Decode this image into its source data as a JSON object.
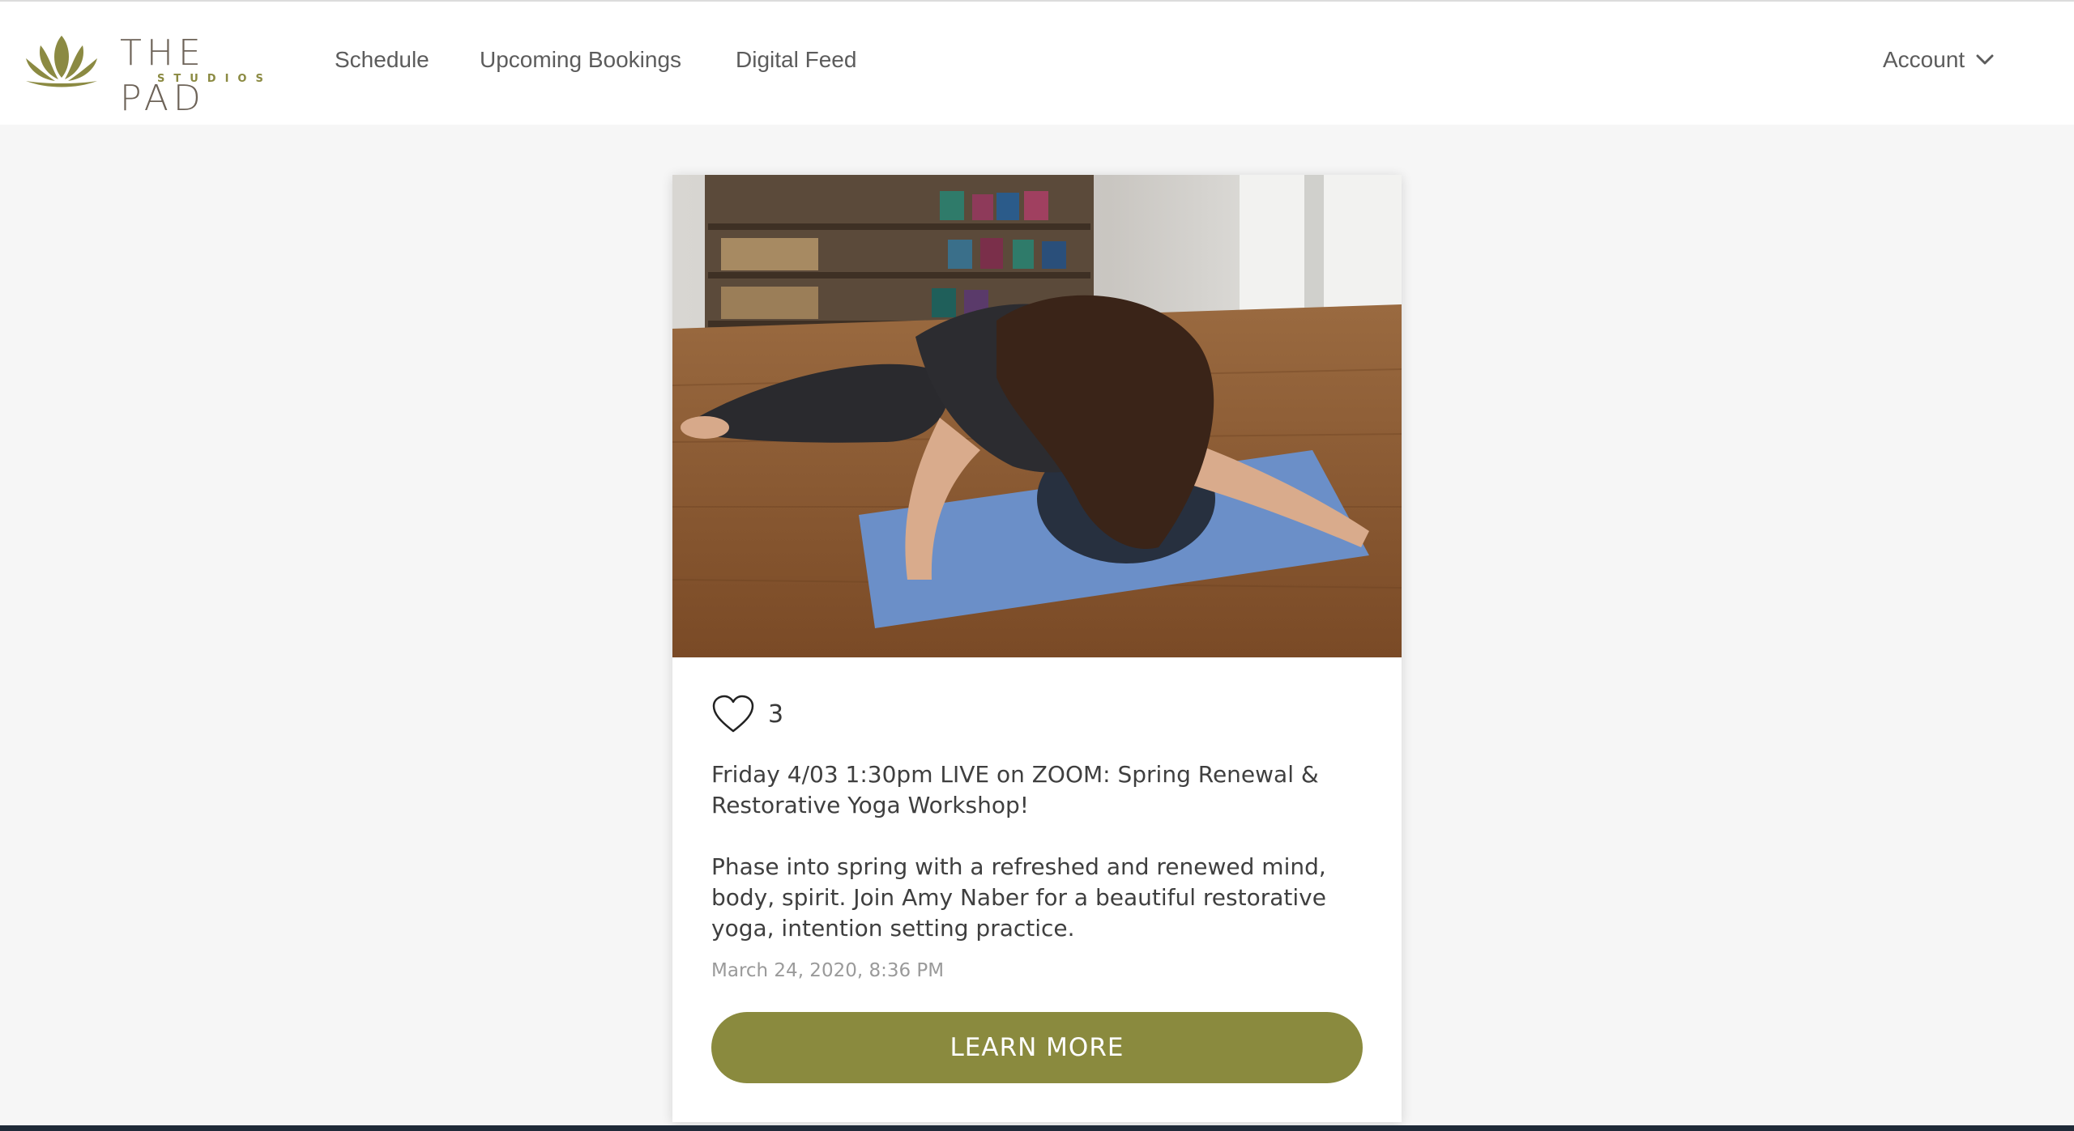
{
  "brand": {
    "name": "THE PAD",
    "sub": "STUDIOS",
    "accent": "#8a8a3e"
  },
  "nav": {
    "items": [
      {
        "label": "Schedule"
      },
      {
        "label": "Upcoming Bookings"
      },
      {
        "label": "Digital Feed"
      }
    ],
    "account_label": "Account",
    "account_icon": "chevron-down-icon"
  },
  "post": {
    "image_alt": "Woman resting in restorative child's pose over a bolster on a blue yoga mat on a wood floor",
    "likes": "3",
    "like_icon": "heart-icon",
    "title": "Friday 4/03 1:30pm LIVE on ZOOM: Spring Renewal & Restorative Yoga Workshop!",
    "description": "Phase into spring with a refreshed and renewed mind, body, spirit. Join Amy Naber for a beautiful restorative yoga, intention setting practice.",
    "timestamp": "March 24, 2020, 8:36 PM",
    "cta_label": "LEARN MORE"
  }
}
